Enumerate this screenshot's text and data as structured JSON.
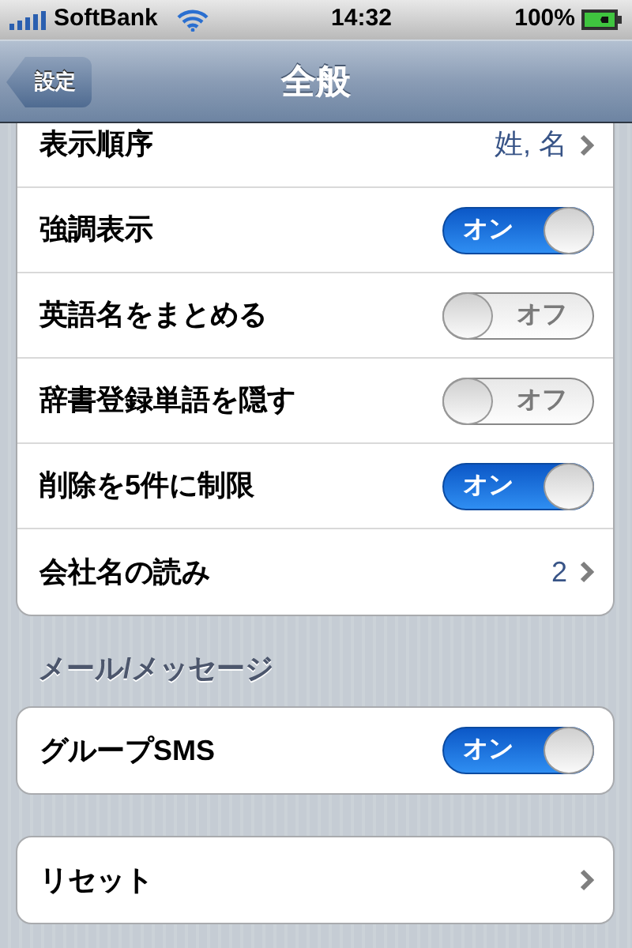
{
  "status_bar": {
    "carrier": "SoftBank",
    "time": "14:32",
    "battery": "100%"
  },
  "nav_bar": {
    "back": "設定",
    "title": "全般"
  },
  "groups": [
    {
      "rows": [
        {
          "kind": "value",
          "label": "表示順序",
          "value": "姓, 名"
        },
        {
          "kind": "toggle",
          "label": "強調表示",
          "on": true,
          "switch_text": "オン"
        },
        {
          "kind": "toggle",
          "label": "英語名をまとめる",
          "on": false,
          "switch_text": "オフ"
        },
        {
          "kind": "toggle",
          "label": "辞書登録単語を隠す",
          "on": false,
          "switch_text": "オフ"
        },
        {
          "kind": "toggle",
          "label": "削除を5件に制限",
          "on": true,
          "switch_text": "オン"
        },
        {
          "kind": "value",
          "label": "会社名の読み",
          "value": "2"
        }
      ]
    },
    {
      "header": "メール/メッセージ",
      "rows": [
        {
          "kind": "toggle",
          "label": "グループSMS",
          "on": true,
          "switch_text": "オン"
        }
      ]
    },
    {
      "rows": [
        {
          "kind": "value",
          "label": "リセット"
        }
      ]
    }
  ]
}
